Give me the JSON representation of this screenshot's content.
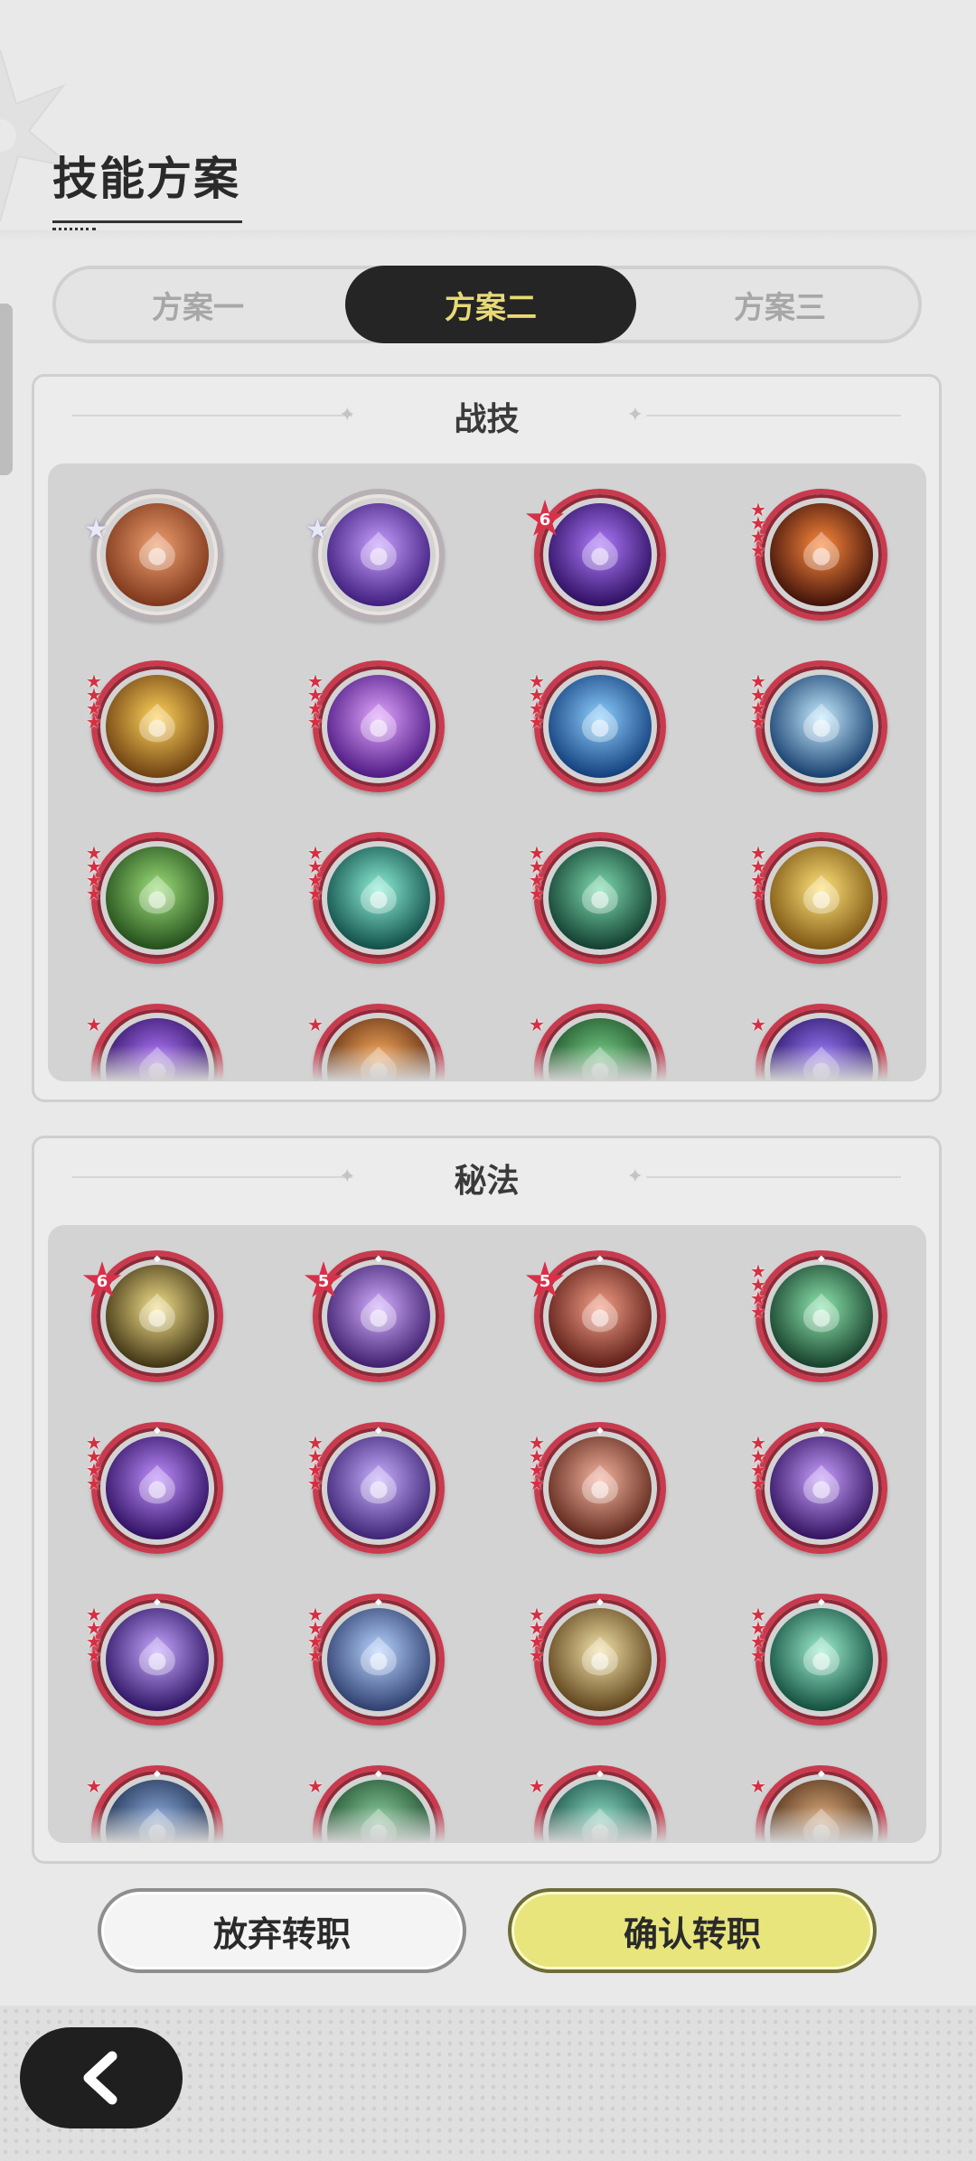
{
  "header": {
    "title": "技能方案"
  },
  "tabs": [
    {
      "label": "方案一",
      "selected": false
    },
    {
      "label": "方案二",
      "selected": true
    },
    {
      "label": "方案三",
      "selected": false
    }
  ],
  "sections": {
    "combat": {
      "title": "战技",
      "skills": [
        {
          "icon": "orange-golem-shield-icon",
          "colors": [
            "#f0a070",
            "#7a3418"
          ],
          "rank": "silver-star"
        },
        {
          "icon": "purple-guardian-icon",
          "colors": [
            "#c9a0ff",
            "#3b1a7a"
          ],
          "rank": "silver-star"
        },
        {
          "icon": "purple-raised-fist-icon",
          "colors": [
            "#b07cff",
            "#2a0c5c"
          ],
          "badge": "6"
        },
        {
          "icon": "fire-vortex-icon",
          "colors": [
            "#ff8a3d",
            "#3a0e08"
          ],
          "stars": 4
        },
        {
          "icon": "golden-rock-golem-icon",
          "colors": [
            "#ffd35a",
            "#6a3c10"
          ],
          "stars": 4
        },
        {
          "icon": "purple-shatter-burst-icon",
          "colors": [
            "#e2a6ff",
            "#4a1580"
          ],
          "stars": 4
        },
        {
          "icon": "frost-golem-icon",
          "colors": [
            "#8fd0ff",
            "#0e3a78"
          ],
          "stars": 4
        },
        {
          "icon": "ice-crystal-burst-icon",
          "colors": [
            "#c6ecff",
            "#123a6a"
          ],
          "stars": 4
        },
        {
          "icon": "green-earth-block-icon",
          "colors": [
            "#9ee07a",
            "#1f4a18"
          ],
          "stars": 4
        },
        {
          "icon": "teal-whirlwind-icon",
          "colors": [
            "#8ff0d8",
            "#0c4a44"
          ],
          "stars": 4
        },
        {
          "icon": "thorn-vines-icon",
          "colors": [
            "#7fdcb0",
            "#0e3a2c"
          ],
          "stars": 4
        },
        {
          "icon": "golden-sparkle-heal-icon",
          "colors": [
            "#ffe37a",
            "#7a5210"
          ],
          "stars": 4
        },
        {
          "icon": "purple-swirl-icon",
          "colors": [
            "#b47cff",
            "#2a0c5c"
          ],
          "stars": 1
        },
        {
          "icon": "amber-flame-icon",
          "colors": [
            "#ffb060",
            "#5a2a10"
          ],
          "stars": 1
        },
        {
          "icon": "green-leaf-icon",
          "colors": [
            "#7ad08a",
            "#184a22"
          ],
          "stars": 1
        },
        {
          "icon": "violet-spike-icon",
          "colors": [
            "#a080ff",
            "#241060"
          ],
          "stars": 1
        }
      ]
    },
    "arcane": {
      "title": "秘法",
      "skills": [
        {
          "icon": "golden-rising-arrows-icon",
          "colors": [
            "#f3e08a",
            "#3a2e10"
          ],
          "badge": "6"
        },
        {
          "icon": "purple-mind-icon",
          "colors": [
            "#d4b0ff",
            "#3a1a6a"
          ],
          "badge": "5"
        },
        {
          "icon": "red-fist-impact-icon",
          "colors": [
            "#f4a088",
            "#5a1a14"
          ],
          "badge": "5"
        },
        {
          "icon": "green-sparkle-orb-icon",
          "colors": [
            "#8fe8b0",
            "#123a26"
          ],
          "stars": 4
        },
        {
          "icon": "violet-compass-orb-icon",
          "colors": [
            "#c090ff",
            "#2a0c5c"
          ],
          "stars": 4
        },
        {
          "icon": "purple-ascend-figure-icon",
          "colors": [
            "#c8b0ff",
            "#3a2070"
          ],
          "stars": 4
        },
        {
          "icon": "coral-wave-orb-icon",
          "colors": [
            "#f6b4a0",
            "#5a2418"
          ],
          "stars": 4
        },
        {
          "icon": "purple-heart-hood-icon",
          "colors": [
            "#c8a0ff",
            "#2e0e5a"
          ],
          "stars": 4
        },
        {
          "icon": "violet-eye-sigil-icon",
          "colors": [
            "#c6a8ff",
            "#2a1060"
          ],
          "stars": 4
        },
        {
          "icon": "steel-crystal-armor-icon",
          "colors": [
            "#b8d4ff",
            "#2a3a6a"
          ],
          "stars": 4
        },
        {
          "icon": "golden-heal-arrow-icon",
          "colors": [
            "#f4e2a8",
            "#5a4018"
          ],
          "stars": 4
        },
        {
          "icon": "teal-silhouette-icon",
          "colors": [
            "#9ff0d0",
            "#0e4a3a"
          ],
          "stars": 4
        },
        {
          "icon": "navy-arrow-icon",
          "colors": [
            "#8fb0e0",
            "#1a2a4a"
          ],
          "stars": 1
        },
        {
          "icon": "green-shield-icon",
          "colors": [
            "#8fd0a0",
            "#1a4a2a"
          ],
          "stars": 1
        },
        {
          "icon": "teal-ring-plus-icon",
          "colors": [
            "#90e0c8",
            "#154a40"
          ],
          "stars": 1
        },
        {
          "icon": "bronze-bear-icon",
          "colors": [
            "#e0b080",
            "#4a2a14"
          ],
          "stars": 1
        }
      ]
    }
  },
  "buttons": {
    "cancel_label": "放弃转职",
    "confirm_label": "确认转职"
  },
  "nav": {
    "back_icon": "chevron-left-icon"
  }
}
